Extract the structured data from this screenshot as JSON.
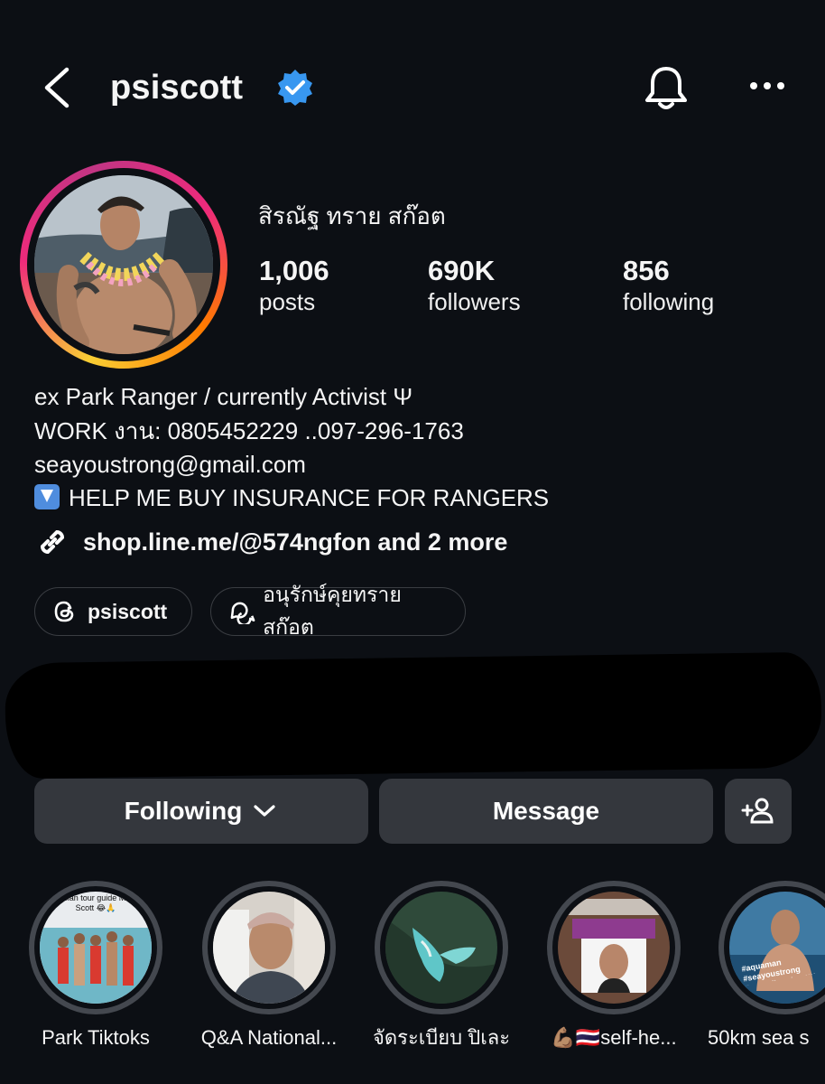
{
  "header": {
    "username": "psiscott",
    "verified": true,
    "icons": [
      "back-arrow-icon",
      "verified-badge-icon",
      "bell-icon",
      "more-options-icon"
    ]
  },
  "profile": {
    "display_name": "สิรณัฐ ทราย สก๊อต",
    "stats": [
      {
        "value": "1,006",
        "label": "posts"
      },
      {
        "value": "690K",
        "label": "followers"
      },
      {
        "value": "856",
        "label": "following"
      }
    ]
  },
  "bio": {
    "lines": [
      "ex Park Ranger / currently Activist Ψ",
      "WORK งาน: 0805452229 ..097-296-1763",
      "seayoustrong@gmail.com",
      "HELP ME BUY INSURANCE FOR RANGERS"
    ],
    "link": "shop.line.me/@574ngfon and 2 more"
  },
  "chips": [
    {
      "label": "psiscott",
      "icon": "threads-icon"
    },
    {
      "label": "อนุรักษ์คุยทรายสก๊อต",
      "icon": "chat-bubbles-icon"
    }
  ],
  "actions": {
    "following": "Following",
    "message": "Message",
    "add_friend_icon": "add-person-icon"
  },
  "highlights": [
    {
      "label": "Park Tiktoks",
      "caption": "russian tour guide M Mr. Scott 😂🙏"
    },
    {
      "label": "Q&A National..."
    },
    {
      "label": "จัดระเบียบ ปิเละ"
    },
    {
      "label": "💪🏽🇹🇭self-he..."
    },
    {
      "label": "50km sea s",
      "caption": "#aquaman #seayoustrong #recordbreaker !!!!"
    }
  ],
  "colors": {
    "background": "#0c0f14",
    "button": "#34373d",
    "verified_blue": "#3897f0"
  }
}
